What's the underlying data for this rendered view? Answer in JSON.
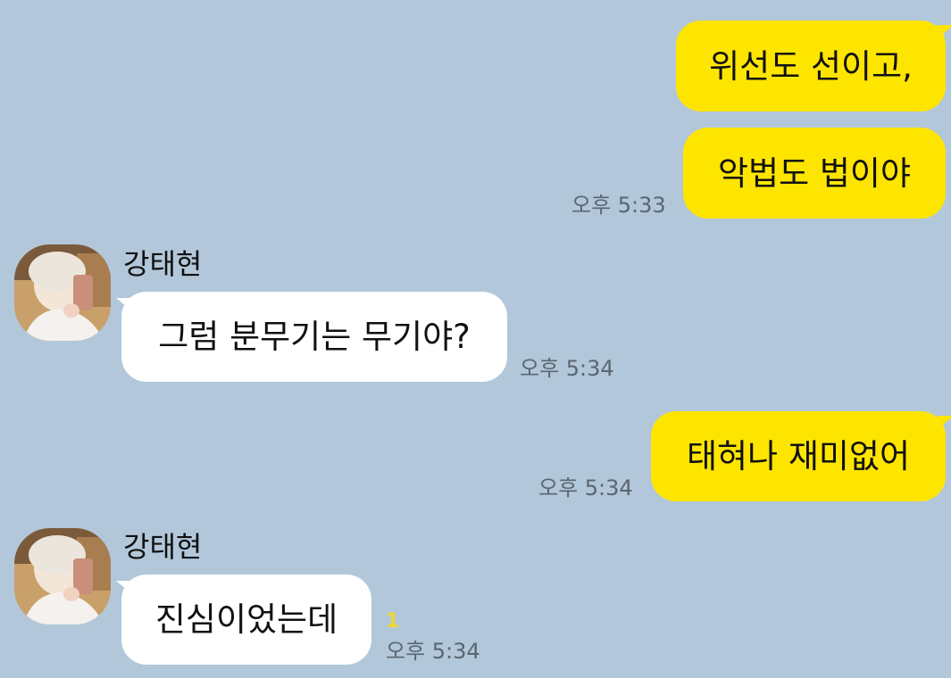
{
  "chat": {
    "messages": [
      {
        "from": "me",
        "text": "위선도 선이고,"
      },
      {
        "from": "me",
        "text": "악법도 법이야",
        "time": "오후 5:33"
      },
      {
        "from": "other",
        "sender": "강태현",
        "text": "그럼 분무기는 무기야?",
        "time": "오후 5:34"
      },
      {
        "from": "me",
        "text": "태혀나 재미없어",
        "time": "오후 5:34"
      },
      {
        "from": "other",
        "sender": "강태현",
        "text": "진심이었는데",
        "time": "오후 5:34",
        "unread": "1"
      }
    ]
  },
  "colors": {
    "background": "#b2c7da",
    "my_bubble": "#fee500",
    "other_bubble": "#ffffff",
    "unread": "#f2d630"
  },
  "icons": {
    "avatar": "profile-photo"
  }
}
